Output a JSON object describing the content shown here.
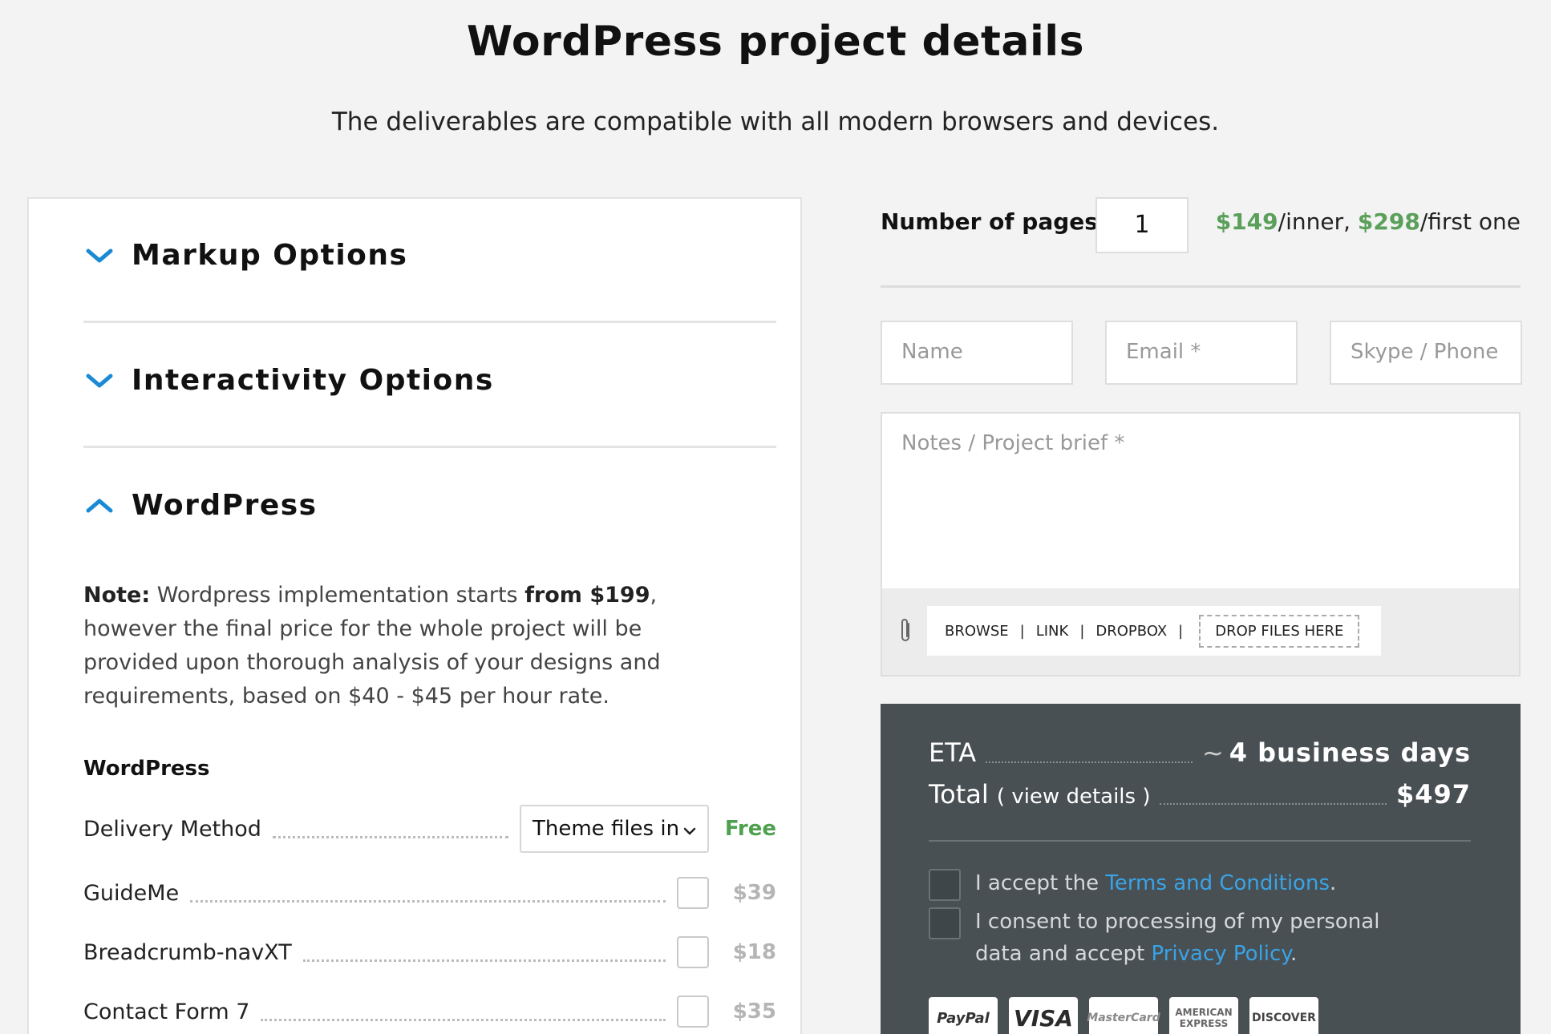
{
  "header": {
    "title": "WordPress project details",
    "subtitle": "The deliverables are compatible with all modern browsers and devices."
  },
  "accordion": {
    "sections": [
      {
        "title": "Markup Options",
        "expanded": false
      },
      {
        "title": "Interactivity Options",
        "expanded": false
      },
      {
        "title": "WordPress",
        "expanded": true
      }
    ],
    "accent_color": "#1a8ad4"
  },
  "note": {
    "label": "Note:",
    "text1": " Wordpress implementation starts ",
    "bold": "from $199",
    "text2": ", however the final price for the whole project will be provided upon thorough analysis of your designs and requirements, based on $40 - $45 per hour rate."
  },
  "wordpress": {
    "heading": "WordPress",
    "delivery": {
      "label": "Delivery Method",
      "selected": "Theme files in",
      "price": "Free"
    },
    "options": [
      {
        "label": "GuideMe",
        "price": "$39",
        "checked": false
      },
      {
        "label": "Breadcrumb-navXT",
        "price": "$18",
        "checked": false
      },
      {
        "label": "Contact Form 7",
        "price": "$35",
        "checked": false
      }
    ]
  },
  "pages": {
    "label": "Number of pages:",
    "value": "1",
    "inner_price": "$149",
    "inner_suffix": "/inner, ",
    "first_price": "$298",
    "first_suffix": "/first one"
  },
  "form": {
    "name_placeholder": "Name",
    "email_placeholder": "Email *",
    "phone_placeholder": "Skype / Phone",
    "notes_placeholder": "Notes / Project brief *"
  },
  "upload": {
    "browse": "BROWSE",
    "link": "LINK",
    "dropbox": "DROPBOX",
    "sep": "|",
    "drop": "DROP FILES HERE"
  },
  "summary": {
    "eta_label": "ETA",
    "eta_tilde": "~",
    "eta_value": "4 business days",
    "total_label": "Total",
    "view_details": "( view details )",
    "total_value": "$497",
    "terms_prefix": "I accept the ",
    "terms_link": "Terms and Conditions",
    "terms_suffix": ".",
    "consent_text": "I consent to processing of my personal data and accept ",
    "privacy_link": "Privacy Policy",
    "privacy_suffix": "."
  },
  "payment_cards": [
    "PayPal",
    "VISA",
    "MasterCard",
    "AMERICAN EXPRESS",
    "DISCOVER"
  ]
}
